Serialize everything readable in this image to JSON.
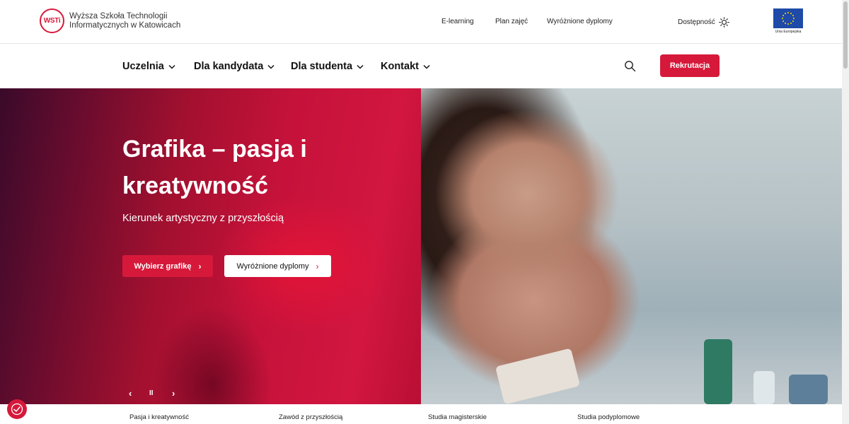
{
  "header": {
    "logo_mark": "WSTi",
    "logo_line1": "Wyższa Szkoła Technologii",
    "logo_line2": "Informatycznych w Katowicach",
    "links": [
      "E-learning",
      "Plan zajęć",
      "Wyróżnione dyplomy"
    ],
    "accessibility_label": "Dostępność",
    "eu_label": "Unia Europejska"
  },
  "nav": {
    "items": [
      "Uczelnia",
      "Dla kandydata",
      "Dla studenta",
      "Kontakt"
    ],
    "cta_label": "Rekrutacja",
    "search_icon": "search-icon"
  },
  "hero": {
    "title": "Grafika – pasja i kreatywność",
    "subtitle": "Kierunek artystyczny z przyszłością",
    "primary_button": "Wybierz grafikę",
    "secondary_button": "Wyróżnione dyplomy",
    "controls": {
      "prev": "‹",
      "pause": "II",
      "next": "›"
    }
  },
  "tabs": [
    "Pasja i kreatywność",
    "Zawód z przyszłością",
    "Studia magisterskie",
    "Studia podyplomowe"
  ],
  "colors": {
    "accent": "#d6193a",
    "eu_blue": "#1f4aa8",
    "eu_star": "#ffdd00"
  }
}
